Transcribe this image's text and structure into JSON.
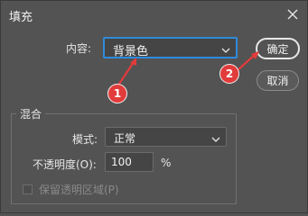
{
  "dialog": {
    "title": "填充",
    "close_icon": "close-icon"
  },
  "contents": {
    "label": "内容:",
    "value": "背景色"
  },
  "buttons": {
    "ok": "确定",
    "cancel": "取消"
  },
  "blending": {
    "group_title": "混合",
    "mode_label": "模式:",
    "mode_value": "正常",
    "opacity_label": "不透明度(O):",
    "opacity_value": "100",
    "opacity_unit": "%",
    "preserve_label": "保留透明区域(P)",
    "preserve_checked": false
  },
  "annotations": {
    "badge_1": "1",
    "badge_2": "2",
    "color": "#e23b3b"
  },
  "colors": {
    "background": "#535353",
    "focus_border": "#2f8bdc"
  }
}
